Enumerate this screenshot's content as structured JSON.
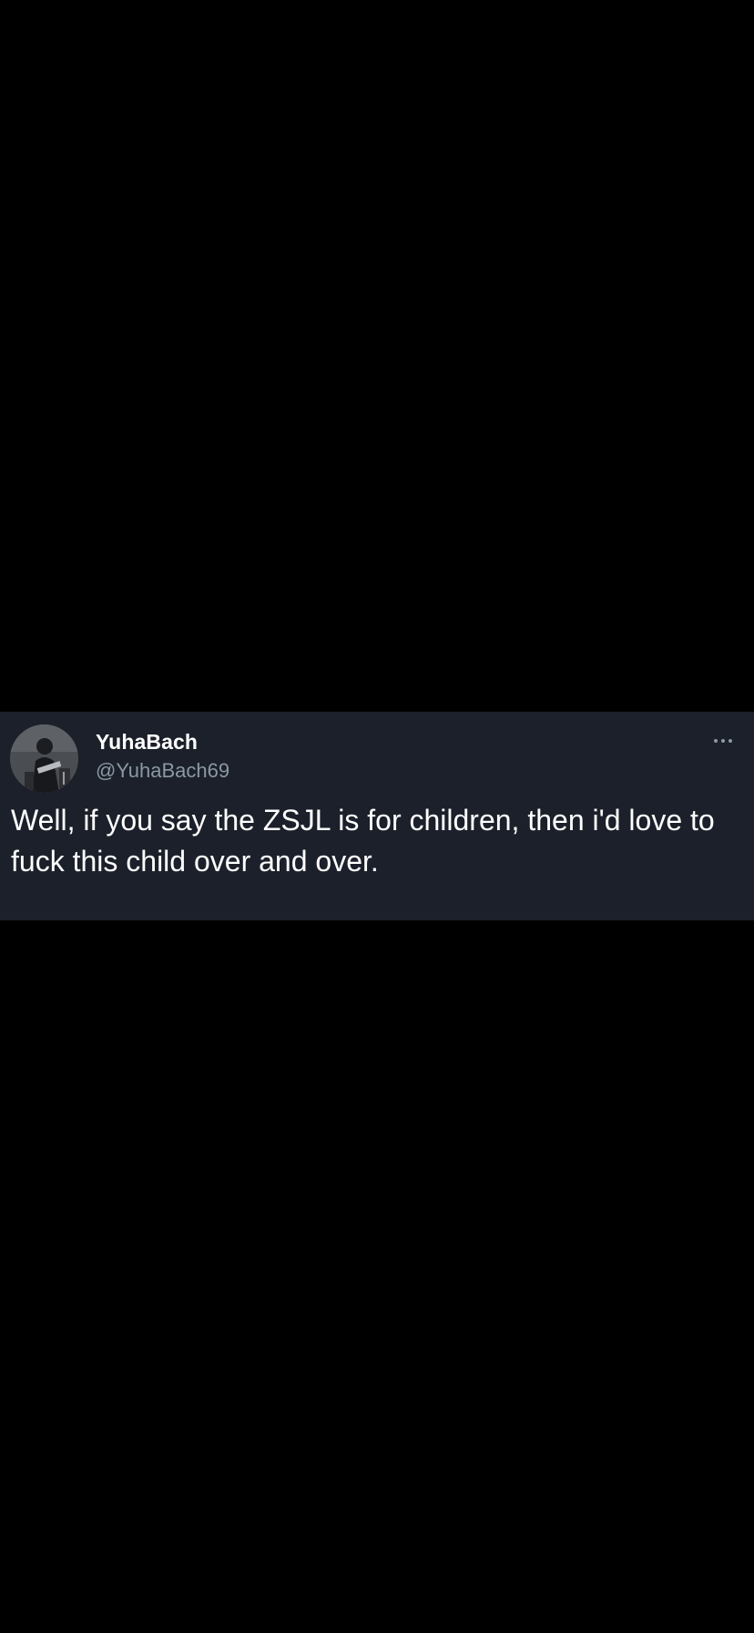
{
  "tweet": {
    "display_name": "YuhaBach",
    "handle": "@YuhaBach69",
    "text": "Well, if you say the ZSJL is for children, then i'd love to fuck this child over and over.",
    "avatar_icon": "user-avatar",
    "more_icon": "more-horizontal-icon"
  },
  "colors": {
    "page_background": "#000000",
    "card_background": "#1b202a",
    "primary_text": "#ffffff",
    "secondary_text": "#8b98a5"
  }
}
